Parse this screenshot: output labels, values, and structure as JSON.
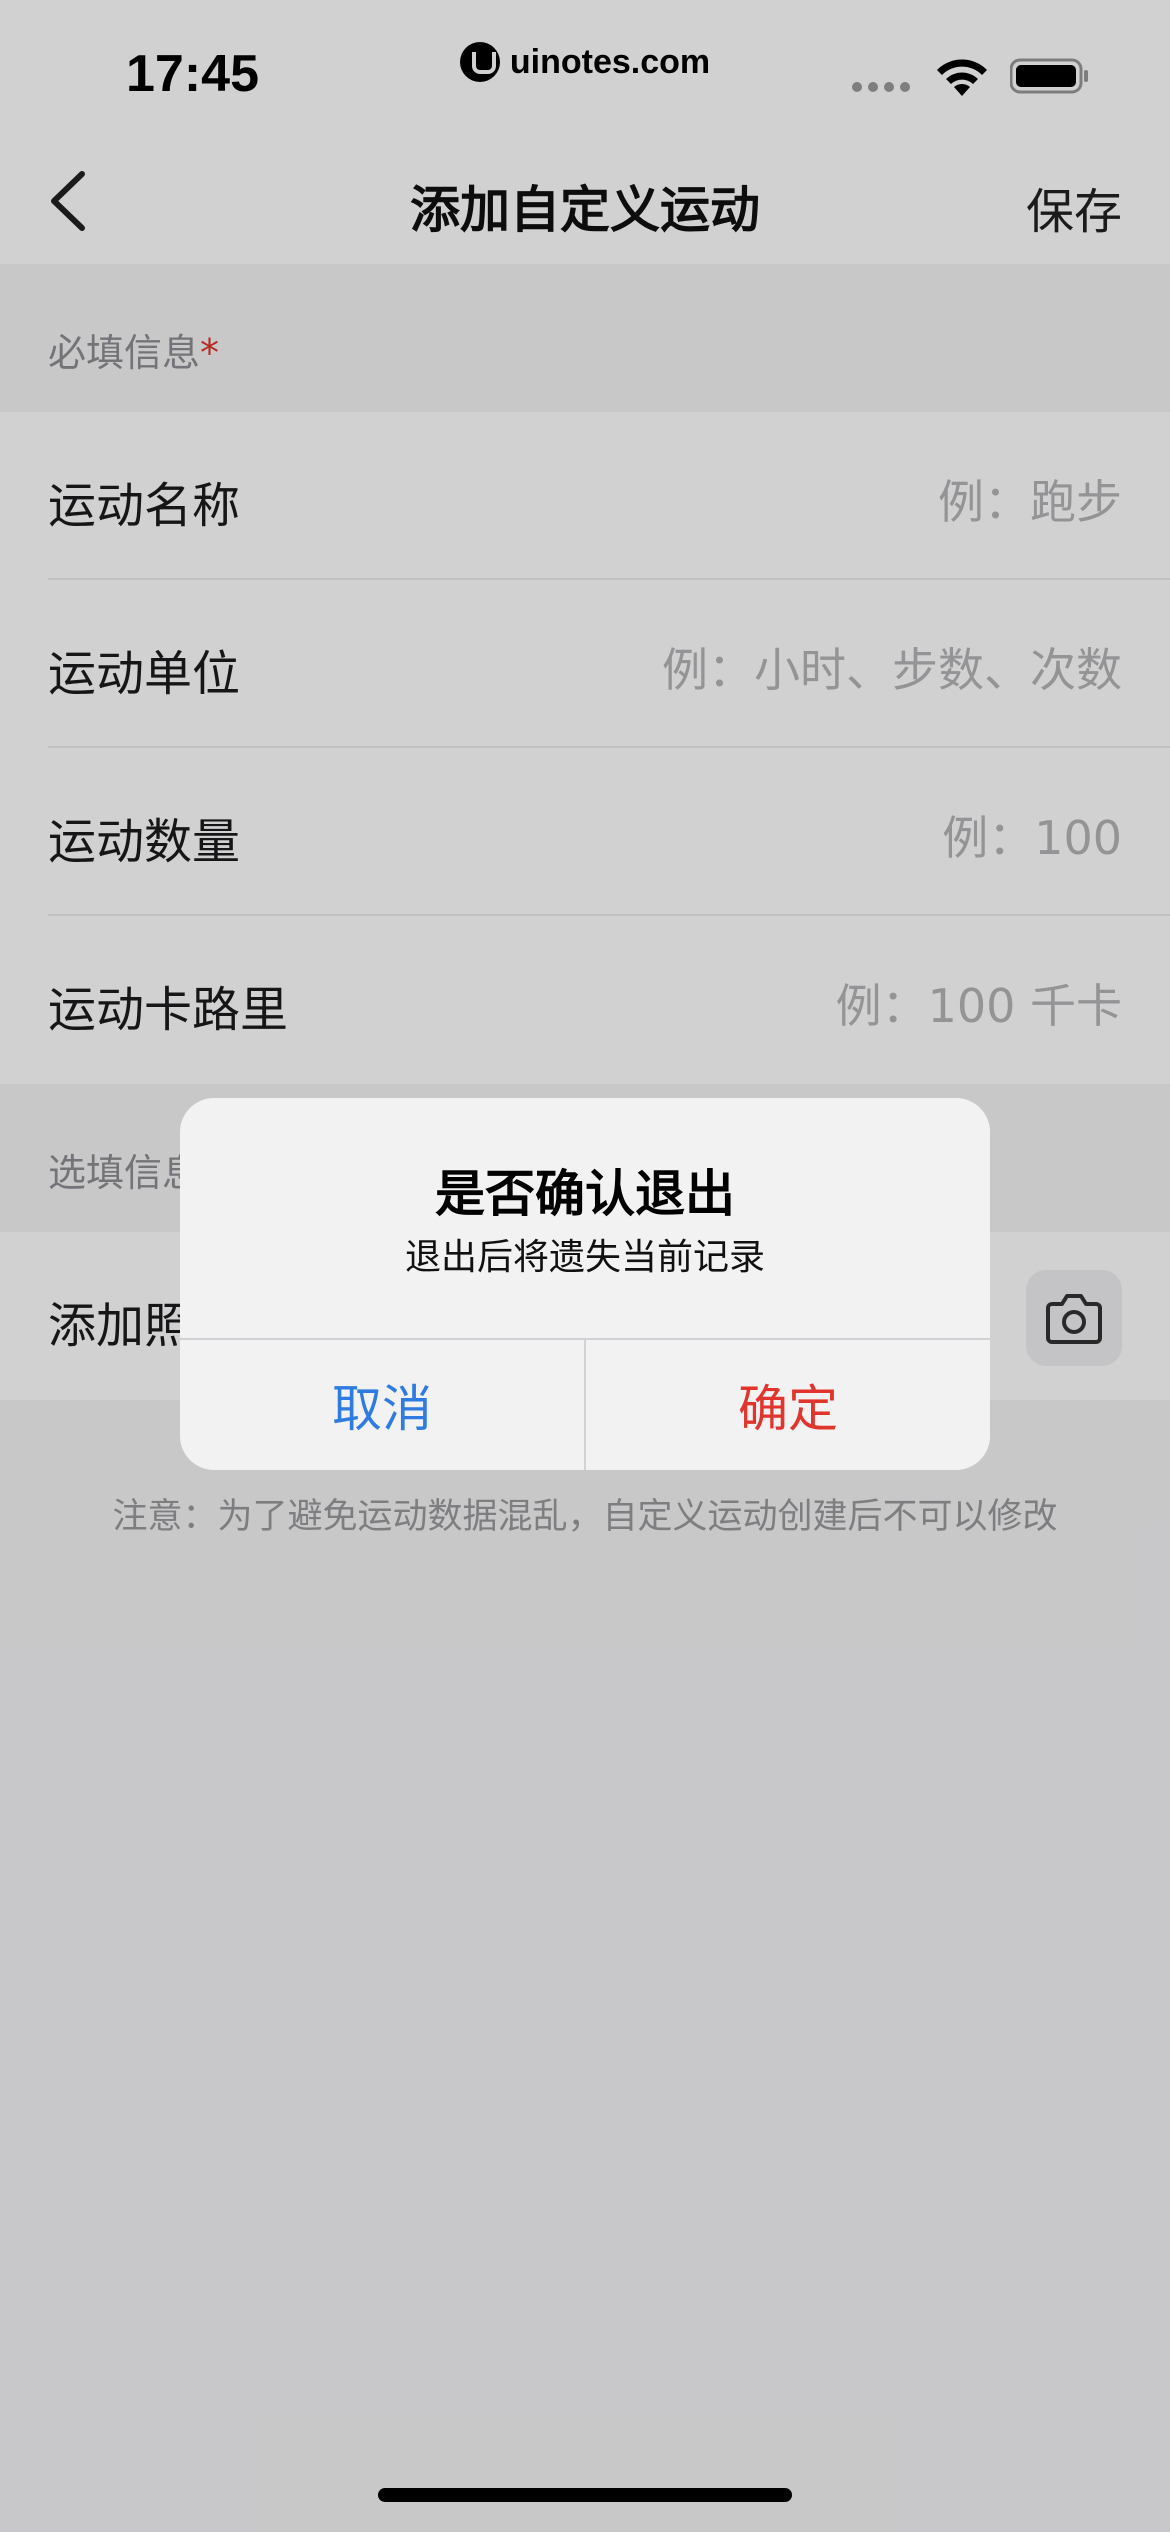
{
  "status_bar": {
    "time": "17:45",
    "watermark": "uinotes.com"
  },
  "nav": {
    "title": "添加自定义运动",
    "save_label": "保存"
  },
  "required_section": {
    "label": "必填信息",
    "required_mark": "*",
    "rows": [
      {
        "label": "运动名称",
        "placeholder": "例：跑步"
      },
      {
        "label": "运动单位",
        "placeholder": "例：小时、步数、次数"
      },
      {
        "label": "运动数量",
        "placeholder": "例：100"
      },
      {
        "label": "运动卡路里",
        "placeholder": "例：100 千卡"
      }
    ]
  },
  "optional_section": {
    "label": "选填信息",
    "rows": [
      {
        "label": "添加照片"
      }
    ]
  },
  "notice": "注意：为了避免运动数据混乱，自定义运动创建后不可以修改",
  "dialog": {
    "title": "是否确认退出",
    "message": "退出后将遗失当前记录",
    "cancel_label": "取消",
    "confirm_label": "确定"
  },
  "colors": {
    "confirm": "#e0342d",
    "cancel": "#2f7be0",
    "required_mark": "#e0342d"
  }
}
